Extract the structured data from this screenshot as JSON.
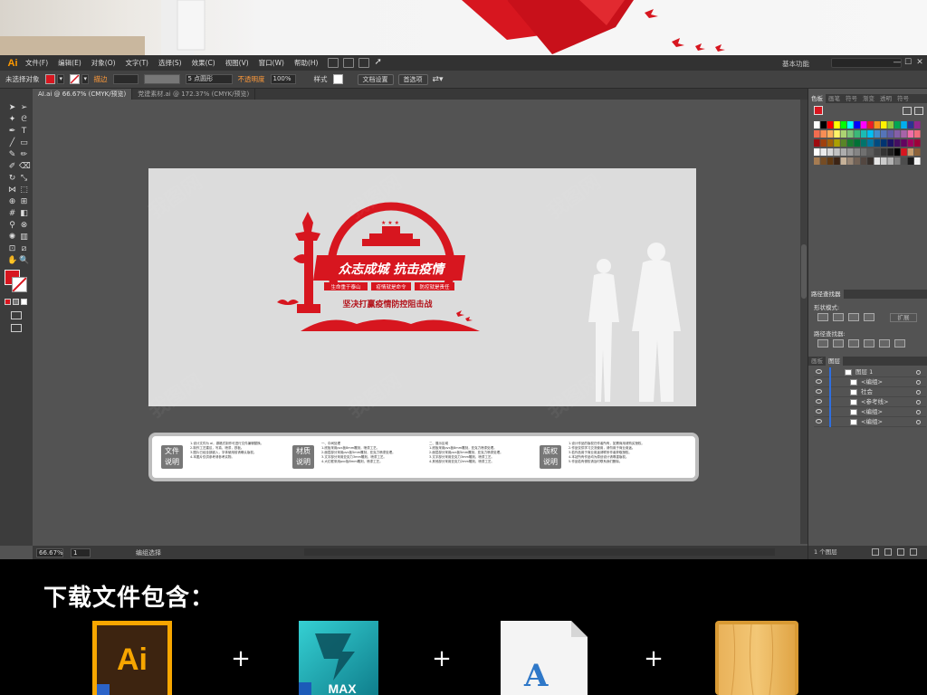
{
  "app": {
    "logo": "Ai",
    "menu": [
      "文件(F)",
      "编辑(E)",
      "对象(O)",
      "文字(T)",
      "选择(S)",
      "效果(C)",
      "视图(V)",
      "窗口(W)",
      "帮助(H)"
    ],
    "workspace": "基本功能",
    "window_controls": [
      "—",
      "☐",
      "✕"
    ]
  },
  "control_bar": {
    "selection_state": "未选择对象",
    "stroke_label": "描边",
    "stroke_options": "5 点圆形",
    "opacity_label": "不透明度",
    "opacity_value": "100%",
    "style_label": "样式",
    "doc_setup": "文档设置",
    "preferences": "首选项"
  },
  "tabs": [
    {
      "label": "AI.ai @ 66.67% (CMYK/预览)",
      "active": true
    },
    {
      "label": "党建素材.ai @ 172.37% (CMYK/预览)",
      "active": false
    }
  ],
  "artwork": {
    "headline": "众志成城 抗击疫情",
    "tags": [
      "生命重于泰山",
      "疫情就是命令",
      "防控就是责任"
    ],
    "subline": "坚决打赢疫情防控阻击战",
    "accent_color": "#d7161f"
  },
  "info_board": {
    "labels": [
      "文件\n说明",
      "材质\n说明",
      "版权\n说明"
    ],
    "file_notes": [
      "1.设计文件为 ai，源格式制作可进行文件编辑替换。",
      "2.制作工艺建议，写真，喷漆，铁板。",
      "3.图片已经全部嵌入，字体使用前请确认版权。",
      "4.本图片仅供参考请参考实物。"
    ],
    "material_notes_a": [
      "一、中间处理",
      "1.底板采用pvc板8mm雕刻，喷漆工艺。",
      "2.面层部分采用pvc板5mm雕刻，亚克力喷漆处理。",
      "3.文字部分采用亚克力3mm雕刻，喷漆工艺。",
      "4.大红框采用pvc板8mm雕刻，喷漆工艺。"
    ],
    "material_notes_b": [
      "二、展示区域",
      "1.底板采用pvc板8mm雕刻，亚克力喷漆处理。",
      "2.面层部分采用pvc板5mm雕刻，亚克力喷漆处理。",
      "3.文字部分采用亚克力3mm雕刻，喷漆工艺。",
      "4.其他部分采用亚克力2mm雕刻，喷漆工艺。"
    ],
    "copyright_notes": [
      "1.设计作品的版权归作者所有，如需商用请购买授权。",
      "2.作品仅供学习交流使用，请勿用于商业用途。",
      "3.若作品用于商业用途请联系作者获取授权。",
      "4.本站所有作品均为原创设计请尊重版权。",
      "5.作品若有侵权请及时联系我们删除。"
    ]
  },
  "panels": {
    "swatch_tabs": [
      "色板",
      "画笔",
      "符号",
      "渐变",
      "透明",
      "符号"
    ],
    "pathfinder_title": "路径查找器",
    "shape_modes": "形状模式:",
    "expand": "扩展",
    "pathfinders": "路径查找器:",
    "layer_tabs": [
      "画板",
      "图层"
    ],
    "layers": [
      {
        "name": "图层 1",
        "indent": 0
      },
      {
        "name": "<编组>",
        "indent": 1
      },
      {
        "name": "社会",
        "indent": 1
      },
      {
        "name": "<参考线>",
        "indent": 1
      },
      {
        "name": "<编组>",
        "indent": 1
      },
      {
        "name": "<编组>",
        "indent": 1
      }
    ],
    "layer_count": "1 个图层"
  },
  "status_bar": {
    "zoom": "66.67%",
    "page": "1",
    "tool_state": "编组选择"
  },
  "footer": {
    "title": "下载文件包含：",
    "plus": "+",
    "ai_icon_text": "Ai",
    "max_icon_text": "MAX",
    "font_icon_text": "A"
  },
  "watermark": "我图网"
}
